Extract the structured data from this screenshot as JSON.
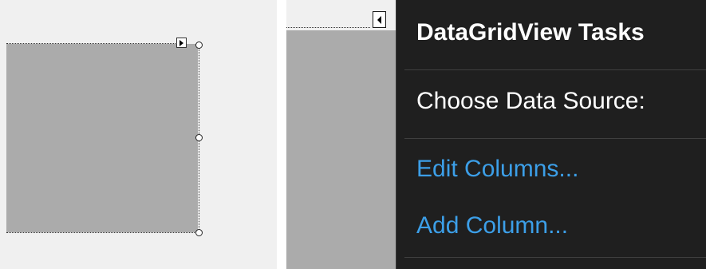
{
  "popup": {
    "title": "DataGridView Tasks",
    "data_source_label": "Choose Data Source:",
    "edit_columns_link": "Edit Columns...",
    "add_column_link": "Add Column..."
  },
  "colors": {
    "designer_background": "#f0f0f0",
    "grid_fill": "#ababab",
    "popup_background": "#1f1f1f",
    "popup_text": "#ffffff",
    "link": "#3c9fe8"
  },
  "icons": {
    "smart_tag_collapsed": "triangle-right-icon",
    "smart_tag_expanded": "triangle-left-icon",
    "resize_handle": "circle-handle-icon"
  }
}
